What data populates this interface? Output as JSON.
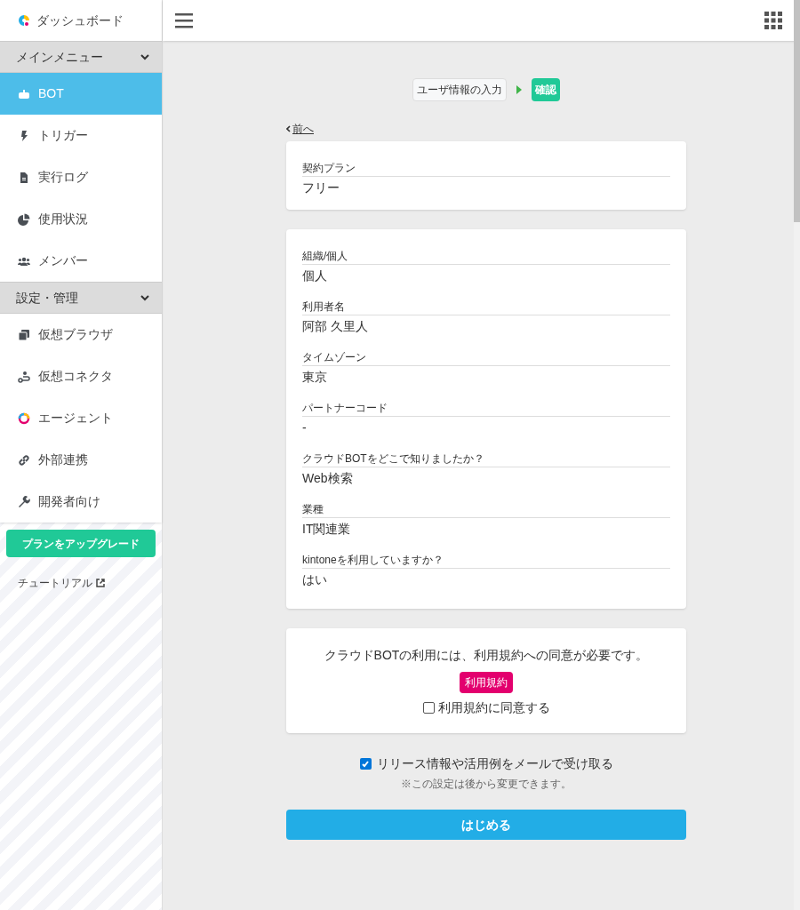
{
  "sidebar": {
    "top_item": {
      "label": "ダッシュボード"
    },
    "sections": [
      {
        "title": "メインメニュー",
        "expanded": true,
        "items": [
          {
            "label": "BOT",
            "selected": true
          },
          {
            "label": "トリガー",
            "selected": false
          },
          {
            "label": "実行ログ",
            "selected": false
          },
          {
            "label": "使用状況",
            "selected": false
          },
          {
            "label": "メンバー",
            "selected": false
          }
        ]
      },
      {
        "title": "設定・管理",
        "expanded": true,
        "items": [
          {
            "label": "仮想ブラウザ",
            "selected": false
          },
          {
            "label": "仮想コネクタ",
            "selected": false
          },
          {
            "label": "エージェント",
            "selected": false
          },
          {
            "label": "外部連携",
            "selected": false
          },
          {
            "label": "開発者向け",
            "selected": false
          }
        ]
      }
    ],
    "upgrade_button": "プランをアップグレード",
    "tutorial_link": "チュートリアル"
  },
  "steps": [
    {
      "label": "ユーザ情報の入力",
      "selected": false
    },
    {
      "label": "確認",
      "selected": true
    }
  ],
  "back_link": "前へ",
  "plan_card": {
    "fields": [
      {
        "label": "契約プラン",
        "value": "フリー"
      }
    ]
  },
  "profile_card": {
    "fields": [
      {
        "label": "組織/個人",
        "value": "個人"
      },
      {
        "label": "利用者名",
        "value": "阿部 久里人"
      },
      {
        "label": "タイムゾーン",
        "value": "東京"
      },
      {
        "label": "パートナーコード",
        "value": "-"
      },
      {
        "label": "クラウドBOTをどこで知りましたか？",
        "value": "Web検索"
      },
      {
        "label": "業種",
        "value": "IT関連業"
      },
      {
        "label": "kintoneを利用していますか？",
        "value": "はい"
      }
    ]
  },
  "terms_card": {
    "message": "クラウドBOTの利用には、利用規約への同意が必要です。",
    "terms_button": "利用規約",
    "agree_checkbox": {
      "label": "利用規約に同意する",
      "checked": false
    }
  },
  "newsletter_checkbox": {
    "label": "リリース情報や活用例をメールで受け取る",
    "checked": true
  },
  "note": "※この設定は後から変更できます。",
  "start_button": "はじめる"
}
